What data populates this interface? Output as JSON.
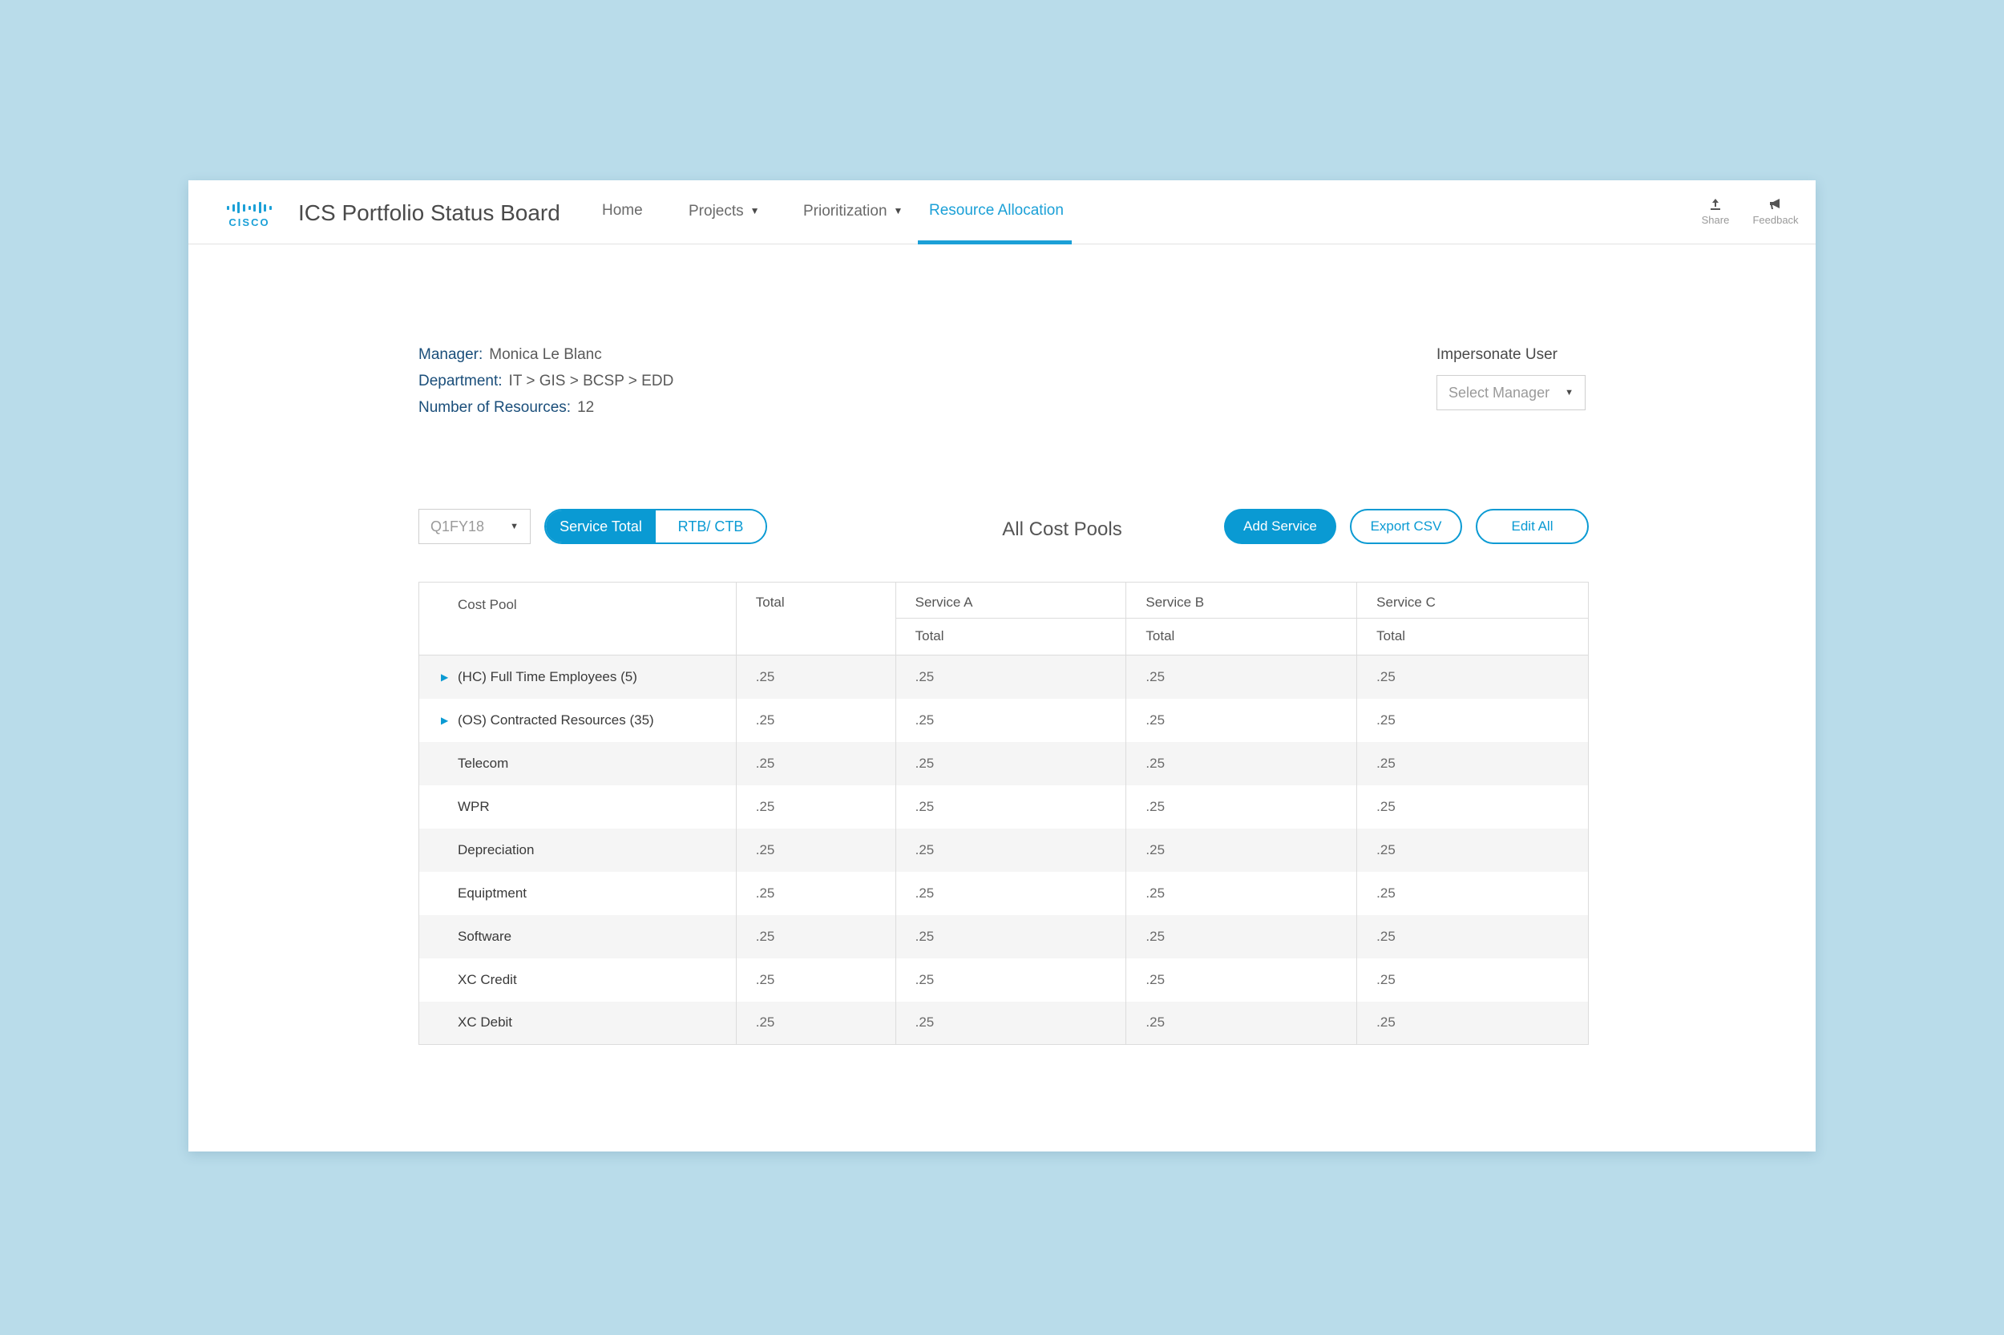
{
  "header": {
    "logo_text": "CISCO",
    "app_title": "ICS Portfolio Status Board",
    "nav": [
      {
        "label": "Home"
      },
      {
        "label": "Projects"
      },
      {
        "label": "Prioritization"
      },
      {
        "label": "Resource Allocation"
      }
    ],
    "active_nav": "Resource Allocation",
    "share_label": "Share",
    "feedback_label": "Feedback"
  },
  "info": {
    "manager_key": "Manager:",
    "manager_val": "Monica Le Blanc",
    "department_key": "Department:",
    "department_val": "IT > GIS > BCSP > EDD",
    "resources_key": "Number of Resources:",
    "resources_val": "12"
  },
  "impersonate": {
    "label": "Impersonate User",
    "placeholder": "Select Manager"
  },
  "toolbar": {
    "period": "Q1FY18",
    "toggle": [
      "Service Total",
      "RTB/ CTB"
    ],
    "toggle_selected": "Service Total",
    "title": "All Cost Pools",
    "add_service": "Add Service",
    "export_csv": "Export CSV",
    "edit_all": "Edit All"
  },
  "table": {
    "headers": {
      "cost_pool": "Cost Pool",
      "total": "Total",
      "services": [
        "Service A",
        "Service B",
        "Service C"
      ],
      "sub": [
        "Total",
        "Total",
        "Total"
      ]
    },
    "rows": [
      {
        "name": "(HC) Full Time Employees (5)",
        "expandable": true,
        "values": [
          ".25",
          ".25",
          ".25",
          ".25"
        ]
      },
      {
        "name": "(OS) Contracted Resources (35)",
        "expandable": true,
        "values": [
          ".25",
          ".25",
          ".25",
          ".25"
        ]
      },
      {
        "name": "Telecom",
        "expandable": false,
        "values": [
          ".25",
          ".25",
          ".25",
          ".25"
        ]
      },
      {
        "name": "WPR",
        "expandable": false,
        "values": [
          ".25",
          ".25",
          ".25",
          ".25"
        ]
      },
      {
        "name": "Depreciation",
        "expandable": false,
        "values": [
          ".25",
          ".25",
          ".25",
          ".25"
        ]
      },
      {
        "name": "Equiptment",
        "expandable": false,
        "values": [
          ".25",
          ".25",
          ".25",
          ".25"
        ]
      },
      {
        "name": "Software",
        "expandable": false,
        "values": [
          ".25",
          ".25",
          ".25",
          ".25"
        ]
      },
      {
        "name": "XC Credit",
        "expandable": false,
        "values": [
          ".25",
          ".25",
          ".25",
          ".25"
        ]
      },
      {
        "name": "XC Debit",
        "expandable": false,
        "values": [
          ".25",
          ".25",
          ".25",
          ".25"
        ]
      }
    ]
  },
  "colors": {
    "accent": "#0a9ad3",
    "background": "#b9dcea",
    "label_dark_blue": "#1a4e7a"
  }
}
